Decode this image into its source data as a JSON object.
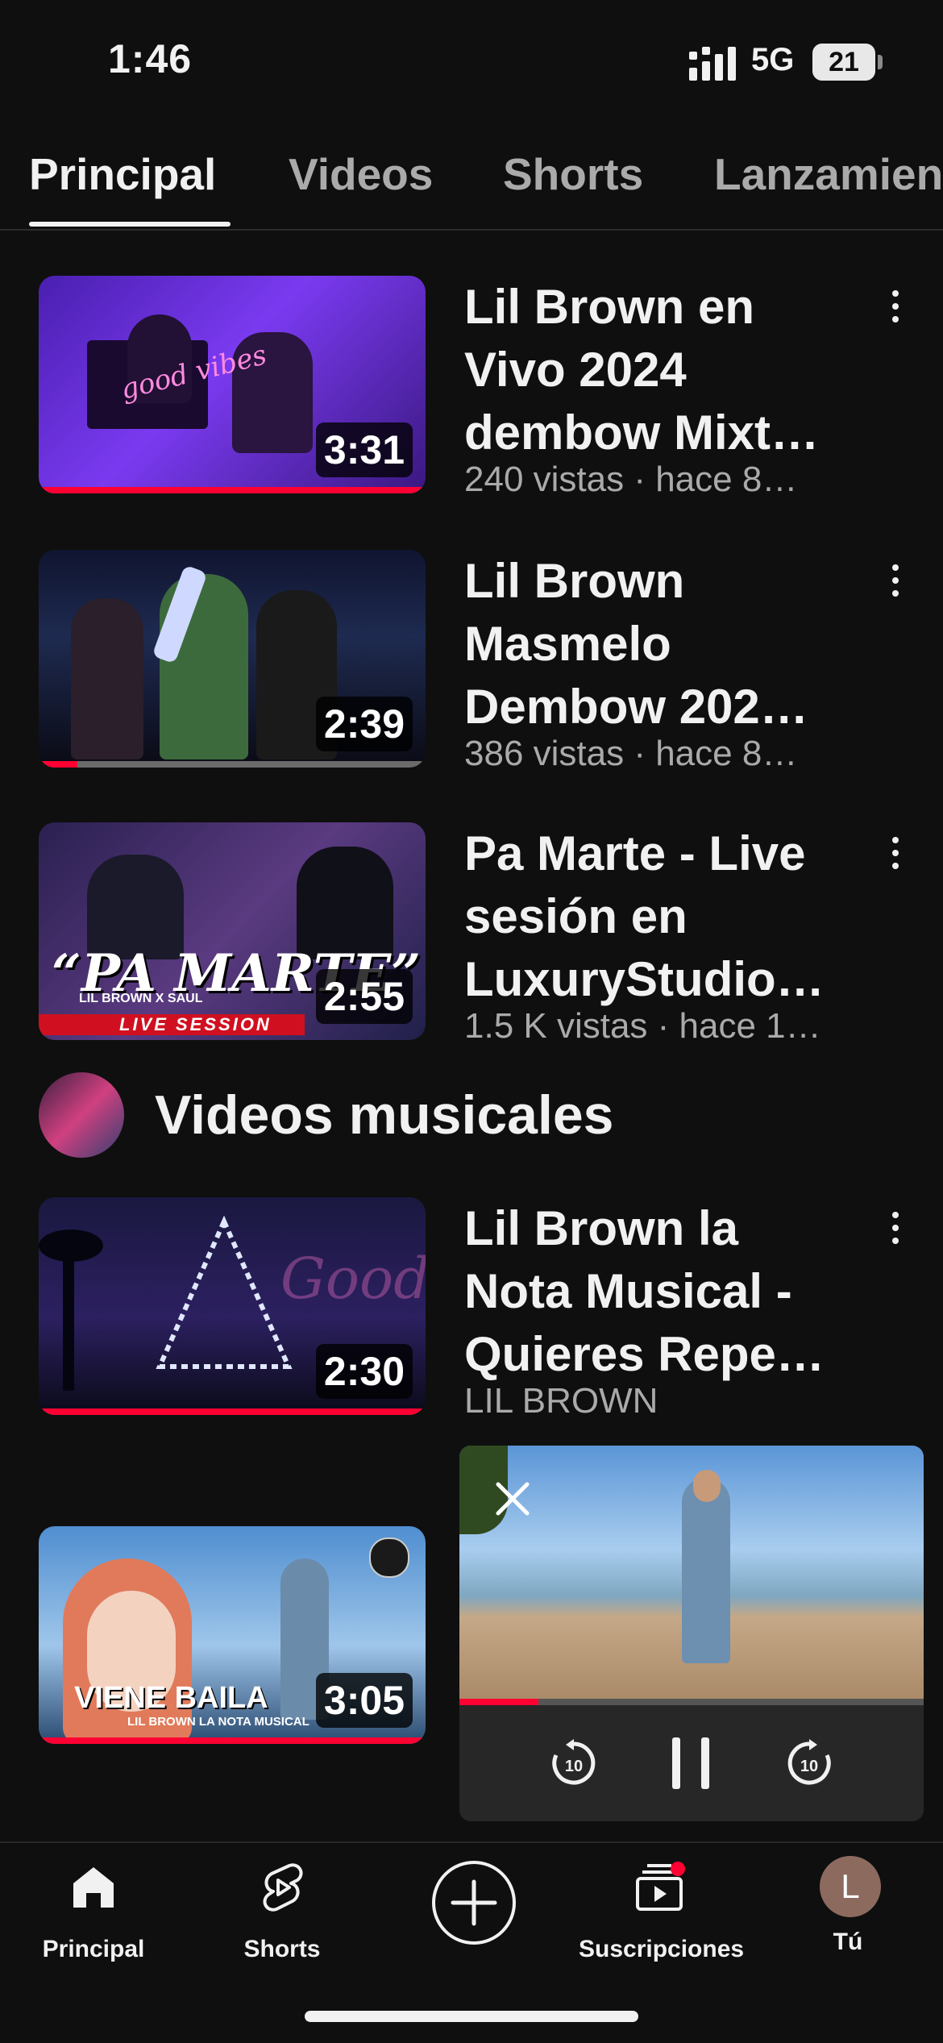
{
  "status": {
    "time": "1:46",
    "network": "5G",
    "battery": "21"
  },
  "tabs": [
    {
      "label": "Principal",
      "active": true
    },
    {
      "label": "Videos",
      "active": false
    },
    {
      "label": "Shorts",
      "active": false
    },
    {
      "label": "Lanzamientos",
      "active": false
    }
  ],
  "videos": [
    {
      "title": "Lil Brown en Vivo 2024 dembow Mixt…",
      "meta": "240 vistas · hace 8…",
      "duration": "3:31",
      "progress": 1.0,
      "thumb_color": "#6a2fd0",
      "thumb_text": "good vibes"
    },
    {
      "title": "Lil Brown Masmelo Dembow 202…",
      "meta": "386 vistas · hace 8…",
      "duration": "2:39",
      "progress": 0.1,
      "thumb_color": "#1a1a2e"
    },
    {
      "title": "Pa Marte - Live sesión en LuxuryStudio…",
      "meta": "1.5 K vistas · hace 1…",
      "duration": "2:55",
      "progress": 0.0,
      "thumb_color": "#3a2a5a",
      "thumb_text": "“PA MARTE”",
      "thumb_sub": "LIL BROWN X SAUL",
      "thumb_banner": "LIVE SESSION"
    },
    {
      "title": "Lil Brown la Nota Musical - Quieres Repe…",
      "meta": "LIL BROWN",
      "duration": "2:30",
      "progress": 1.0,
      "thumb_color": "#1c1a3a"
    },
    {
      "title": "",
      "meta": "",
      "duration": "3:05",
      "progress": 1.0,
      "thumb_color": "#6fa4d8",
      "thumb_text": "VIENE BAILA",
      "thumb_sub": "LIL BROWN LA NOTA MUSICAL"
    }
  ],
  "section": {
    "heading": "Videos musicales",
    "avatar_icon": "channel-avatar"
  },
  "miniplayer": {
    "progress": 0.17,
    "icons": [
      "close-icon",
      "replay-10-icon",
      "pause-icon",
      "forward-10-icon"
    ]
  },
  "nav": {
    "home": "Principal",
    "shorts": "Shorts",
    "subscriptions": "Suscripciones",
    "you": "Tú",
    "profile_initial": "L"
  },
  "colors": {
    "accent": "#ff0033",
    "background": "#0f0f0f",
    "secondary_text": "#aaaaaa"
  }
}
